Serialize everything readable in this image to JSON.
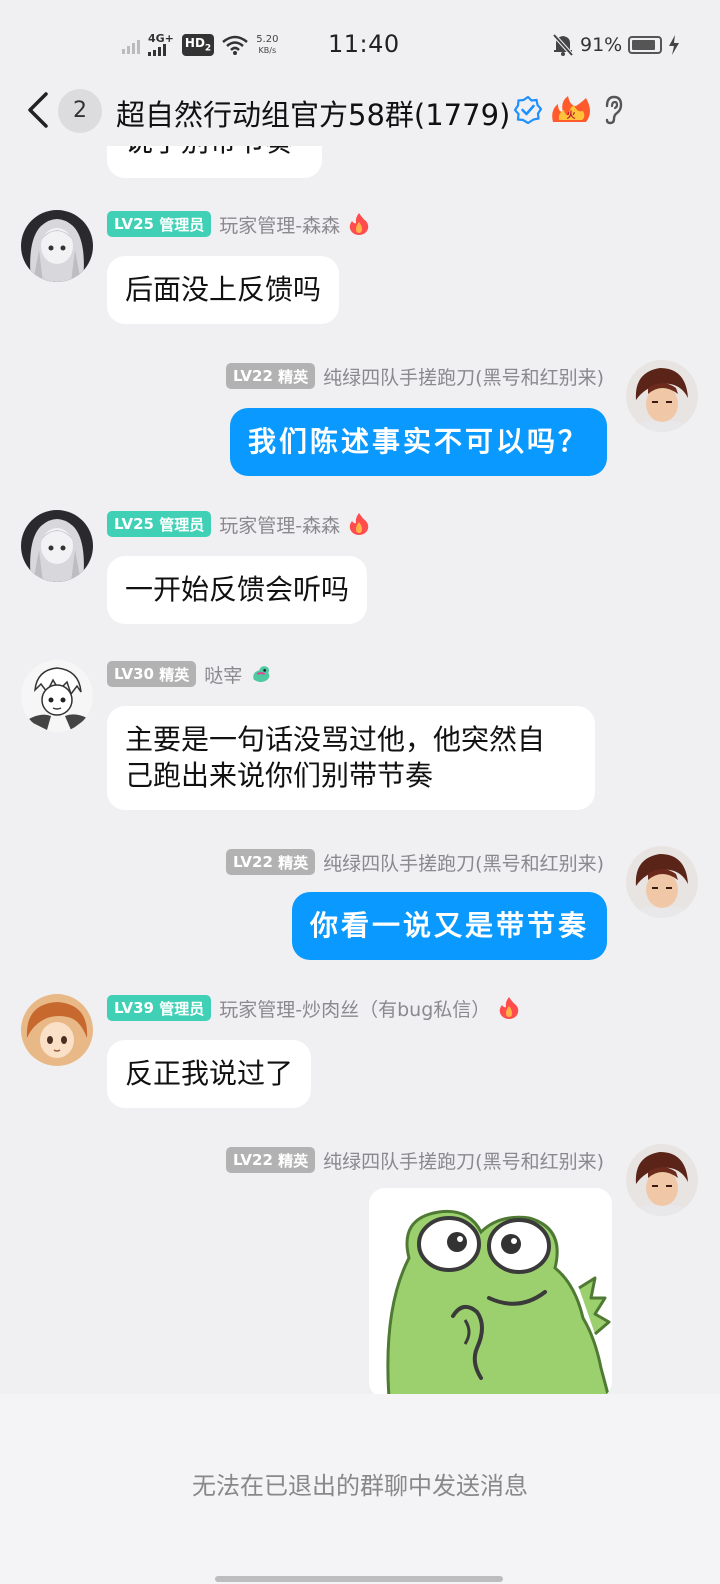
{
  "status_bar": {
    "network": "4G+",
    "hd": "HD",
    "hd_sub": "2",
    "speed_value": "5.20",
    "speed_unit": "KB/s",
    "time": "11:40",
    "battery_pct": "91%",
    "battery_level": 0.91
  },
  "header": {
    "unread_count": "2",
    "title": "超自然行动组官方58群(1779)"
  },
  "messages": [
    {
      "sender": "",
      "level": "",
      "role": "",
      "text": "说了别带节奏",
      "partial": true
    },
    {
      "sender": "玩家管理-森森",
      "level": "LV25",
      "role": "管理员",
      "text": "后面没上反馈吗"
    },
    {
      "sender": "纯绿四队手搓跑刀(黑号和红别来)",
      "level": "LV22",
      "role": "精英",
      "text": "我们陈述事实不可以吗？",
      "self": true
    },
    {
      "sender": "玩家管理-森森",
      "level": "LV25",
      "role": "管理员",
      "text": "一开始反馈会听吗"
    },
    {
      "sender": "哒宰",
      "level": "LV30",
      "role": "精英",
      "text_line1": "主要是一句话没骂过他，他突然自",
      "text_line2": "己跑出来说你们别带节奏"
    },
    {
      "sender": "纯绿四队手搓跑刀(黑号和红别来)",
      "level": "LV22",
      "role": "精英",
      "text": "你看一说又是带节奏",
      "self": true
    },
    {
      "sender": "玩家管理-炒肉丝（有bug私信）",
      "level": "LV39",
      "role": "管理员",
      "text": "反正我说过了"
    },
    {
      "sender": "纯绿四队手搓跑刀(黑号和红别来)",
      "level": "LV22",
      "role": "精英",
      "sticker": "green-frog-sticker",
      "self": true
    }
  ],
  "footer": {
    "disabled_note": "无法在已退出的群聊中发送消息"
  },
  "colors": {
    "accent": "#0a99ff",
    "admin_badge": "#3fd0b6",
    "elite_badge": "#b2b2b2",
    "background": "#f0f0f3"
  }
}
